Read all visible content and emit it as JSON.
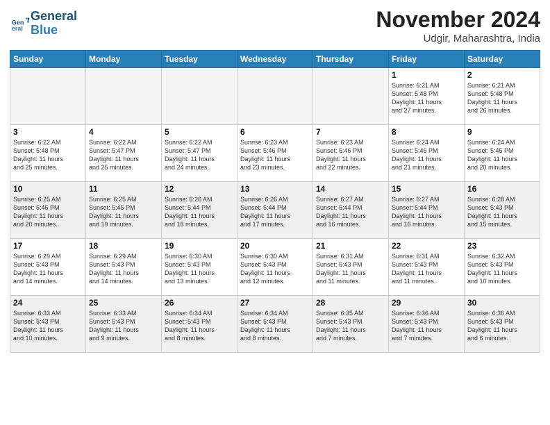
{
  "header": {
    "logo_line1": "General",
    "logo_line2": "Blue",
    "month": "November 2024",
    "location": "Udgir, Maharashtra, India"
  },
  "weekdays": [
    "Sunday",
    "Monday",
    "Tuesday",
    "Wednesday",
    "Thursday",
    "Friday",
    "Saturday"
  ],
  "rows": [
    [
      {
        "day": "",
        "info": ""
      },
      {
        "day": "",
        "info": ""
      },
      {
        "day": "",
        "info": ""
      },
      {
        "day": "",
        "info": ""
      },
      {
        "day": "",
        "info": ""
      },
      {
        "day": "1",
        "info": "Sunrise: 6:21 AM\nSunset: 5:48 PM\nDaylight: 11 hours\nand 27 minutes."
      },
      {
        "day": "2",
        "info": "Sunrise: 6:21 AM\nSunset: 5:48 PM\nDaylight: 11 hours\nand 26 minutes."
      }
    ],
    [
      {
        "day": "3",
        "info": "Sunrise: 6:22 AM\nSunset: 5:48 PM\nDaylight: 11 hours\nand 25 minutes."
      },
      {
        "day": "4",
        "info": "Sunrise: 6:22 AM\nSunset: 5:47 PM\nDaylight: 11 hours\nand 25 minutes."
      },
      {
        "day": "5",
        "info": "Sunrise: 6:22 AM\nSunset: 5:47 PM\nDaylight: 11 hours\nand 24 minutes."
      },
      {
        "day": "6",
        "info": "Sunrise: 6:23 AM\nSunset: 5:46 PM\nDaylight: 11 hours\nand 23 minutes."
      },
      {
        "day": "7",
        "info": "Sunrise: 6:23 AM\nSunset: 5:46 PM\nDaylight: 11 hours\nand 22 minutes."
      },
      {
        "day": "8",
        "info": "Sunrise: 6:24 AM\nSunset: 5:46 PM\nDaylight: 11 hours\nand 21 minutes."
      },
      {
        "day": "9",
        "info": "Sunrise: 6:24 AM\nSunset: 5:45 PM\nDaylight: 11 hours\nand 20 minutes."
      }
    ],
    [
      {
        "day": "10",
        "info": "Sunrise: 6:25 AM\nSunset: 5:45 PM\nDaylight: 11 hours\nand 20 minutes."
      },
      {
        "day": "11",
        "info": "Sunrise: 6:25 AM\nSunset: 5:45 PM\nDaylight: 11 hours\nand 19 minutes."
      },
      {
        "day": "12",
        "info": "Sunrise: 6:26 AM\nSunset: 5:44 PM\nDaylight: 11 hours\nand 18 minutes."
      },
      {
        "day": "13",
        "info": "Sunrise: 6:26 AM\nSunset: 5:44 PM\nDaylight: 11 hours\nand 17 minutes."
      },
      {
        "day": "14",
        "info": "Sunrise: 6:27 AM\nSunset: 5:44 PM\nDaylight: 11 hours\nand 16 minutes."
      },
      {
        "day": "15",
        "info": "Sunrise: 6:27 AM\nSunset: 5:44 PM\nDaylight: 11 hours\nand 16 minutes."
      },
      {
        "day": "16",
        "info": "Sunrise: 6:28 AM\nSunset: 5:43 PM\nDaylight: 11 hours\nand 15 minutes."
      }
    ],
    [
      {
        "day": "17",
        "info": "Sunrise: 6:29 AM\nSunset: 5:43 PM\nDaylight: 11 hours\nand 14 minutes."
      },
      {
        "day": "18",
        "info": "Sunrise: 6:29 AM\nSunset: 5:43 PM\nDaylight: 11 hours\nand 14 minutes."
      },
      {
        "day": "19",
        "info": "Sunrise: 6:30 AM\nSunset: 5:43 PM\nDaylight: 11 hours\nand 13 minutes."
      },
      {
        "day": "20",
        "info": "Sunrise: 6:30 AM\nSunset: 5:43 PM\nDaylight: 11 hours\nand 12 minutes."
      },
      {
        "day": "21",
        "info": "Sunrise: 6:31 AM\nSunset: 5:43 PM\nDaylight: 11 hours\nand 11 minutes."
      },
      {
        "day": "22",
        "info": "Sunrise: 6:31 AM\nSunset: 5:43 PM\nDaylight: 11 hours\nand 11 minutes."
      },
      {
        "day": "23",
        "info": "Sunrise: 6:32 AM\nSunset: 5:43 PM\nDaylight: 11 hours\nand 10 minutes."
      }
    ],
    [
      {
        "day": "24",
        "info": "Sunrise: 6:33 AM\nSunset: 5:43 PM\nDaylight: 11 hours\nand 10 minutes."
      },
      {
        "day": "25",
        "info": "Sunrise: 6:33 AM\nSunset: 5:43 PM\nDaylight: 11 hours\nand 9 minutes."
      },
      {
        "day": "26",
        "info": "Sunrise: 6:34 AM\nSunset: 5:43 PM\nDaylight: 11 hours\nand 8 minutes."
      },
      {
        "day": "27",
        "info": "Sunrise: 6:34 AM\nSunset: 5:43 PM\nDaylight: 11 hours\nand 8 minutes."
      },
      {
        "day": "28",
        "info": "Sunrise: 6:35 AM\nSunset: 5:43 PM\nDaylight: 11 hours\nand 7 minutes."
      },
      {
        "day": "29",
        "info": "Sunrise: 6:36 AM\nSunset: 5:43 PM\nDaylight: 11 hours\nand 7 minutes."
      },
      {
        "day": "30",
        "info": "Sunrise: 6:36 AM\nSunset: 5:43 PM\nDaylight: 11 hours\nand 6 minutes."
      }
    ]
  ]
}
